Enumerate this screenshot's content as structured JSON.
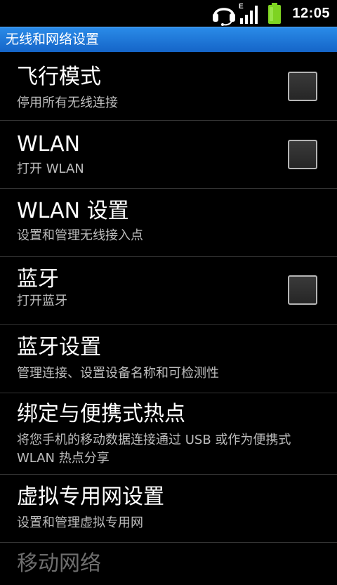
{
  "status_bar": {
    "time": "12:05",
    "network_type": "E",
    "icons": [
      "headset-icon",
      "signal-icon",
      "battery-icon"
    ],
    "battery_color": "#7ed321"
  },
  "title_bar": {
    "title": "无线和网络设置",
    "color": "#1e78d8"
  },
  "items": [
    {
      "title": "飞行模式",
      "summary": "停用所有无线连接",
      "has_checkbox": true,
      "checked": false
    },
    {
      "title": "WLAN",
      "summary": "打开 WLAN",
      "has_checkbox": true,
      "checked": false
    },
    {
      "title": "WLAN 设置",
      "summary": "设置和管理无线接入点",
      "has_checkbox": false
    },
    {
      "title": "蓝牙",
      "summary": "打开蓝牙",
      "has_checkbox": true,
      "checked": false
    },
    {
      "title": "蓝牙设置",
      "summary": "管理连接、设置设备名称和可检测性",
      "has_checkbox": false
    },
    {
      "title": "绑定与便携式热点",
      "summary": "将您手机的移动数据连接通过 USB 或作为便携式 WLAN 热点分享",
      "has_checkbox": false
    },
    {
      "title": "虚拟专用网设置",
      "summary": "设置和管理虚拟专用网",
      "has_checkbox": false
    },
    {
      "title": "移动网络",
      "has_checkbox": false
    }
  ]
}
